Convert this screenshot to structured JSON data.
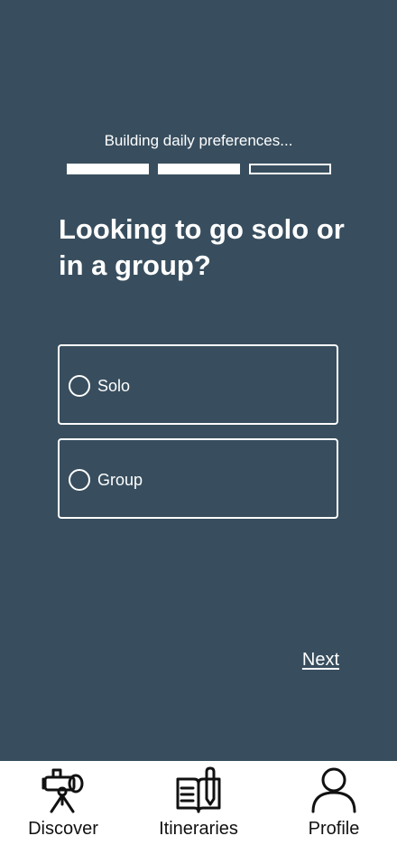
{
  "colors": {
    "background": "#384e5e",
    "foreground": "#ffffff",
    "nav_background": "#ffffff",
    "nav_text": "#111111"
  },
  "status_text": "Building daily preferences...",
  "progress": {
    "total_steps": 3,
    "completed_steps": 2
  },
  "question": "Looking to go solo or in a group?",
  "options": [
    {
      "label": "Solo",
      "selected": false
    },
    {
      "label": "Group",
      "selected": false
    }
  ],
  "next_label": "Next",
  "nav": {
    "items": [
      {
        "label": "Discover",
        "icon": "telescope-icon"
      },
      {
        "label": "Itineraries",
        "icon": "book-pen-icon"
      },
      {
        "label": "Profile",
        "icon": "person-icon"
      }
    ]
  }
}
